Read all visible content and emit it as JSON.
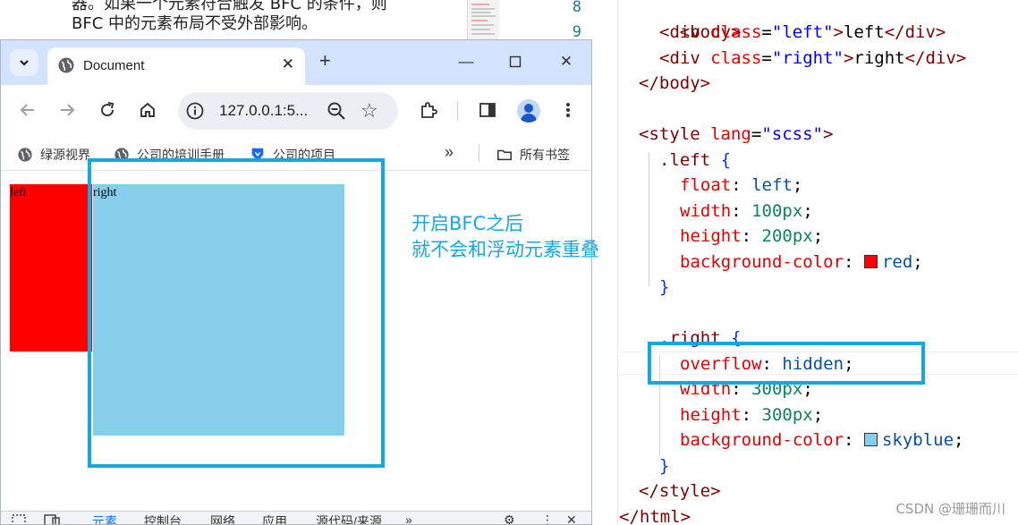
{
  "article": {
    "line1": "器。如果一个元素符合触发 BFC 的条件，则",
    "line2": "BFC 中的元素布局不受外部影响。"
  },
  "editor": {
    "line_numbers": [
      "8",
      "9"
    ],
    "code": {
      "l1_tag": "<body>",
      "l2_open": "<div",
      "l2_attr": "class",
      "l2_eq": "=",
      "l2_val": "\"left\"",
      "l2_gt": ">",
      "l2_text": "left",
      "l2_close": "</div>",
      "l3_open": "<div",
      "l3_attr": "class",
      "l3_eq": "=",
      "l3_val": "\"right\"",
      "l3_gt": ">",
      "l3_text": "right",
      "l3_close": "</div>",
      "l4_tag": "</body>",
      "l6_open": "<style",
      "l6_attr": "lang",
      "l6_eq": "=",
      "l6_val": "\"scss\"",
      "l6_gt": ">",
      "l7_sel": ".left",
      "l7_brace": "{",
      "l8_prop": "float",
      "l8_colon": ":",
      "l8_val": "left",
      "l8_semi": ";",
      "l9_prop": "width",
      "l9_colon": ":",
      "l9_val": "100px",
      "l9_semi": ";",
      "l10_prop": "height",
      "l10_colon": ":",
      "l10_val": "200px",
      "l10_semi": ";",
      "l11_prop": "background-color",
      "l11_colon": ":",
      "l11_val": "red",
      "l11_semi": ";",
      "l12_brace": "}",
      "l14_sel": ".right",
      "l14_brace": "{",
      "l15_prop": "overflow",
      "l15_colon": ":",
      "l15_val": "hidden",
      "l15_semi": ";",
      "l16_prop": "width",
      "l16_colon": ":",
      "l16_val": "300px",
      "l16_semi": ";",
      "l17_prop": "height",
      "l17_colon": ":",
      "l17_val": "300px",
      "l17_semi": ";",
      "l18_prop": "background-color",
      "l18_colon": ":",
      "l18_val": "skyblue",
      "l18_semi": ";",
      "l19_brace": "}",
      "l20_tag": "</style>",
      "l21_tag": "</html>"
    },
    "swatch_red": "#ff0000",
    "swatch_skyblue": "#87ceeb"
  },
  "browser": {
    "tab_title": "Document",
    "new_tab": "+",
    "url": "127.0.0.1:5...",
    "bookmarks": [
      "绿源视界",
      "公司的培训手册",
      "公司的项目"
    ],
    "bookmarks_more": "»",
    "all_bookmarks": "所有书签",
    "page": {
      "left_label": "left",
      "right_label": "right"
    },
    "devtools_tabs": [
      "元素",
      "控制台",
      "网络",
      "应用",
      "源代码/来源"
    ],
    "devtools_more": "»"
  },
  "annotation": {
    "line1": "开启BFC之后",
    "line2": "就不会和浮动元素重叠",
    "color": "#14a8e0"
  },
  "watermark": "CSDN @珊珊而川",
  "icons": {
    "tab_search": "chevron-down-icon",
    "tab_favicon": "globe-icon",
    "close": "close-icon",
    "minimize": "minimize-icon",
    "maximize": "maximize-icon",
    "back": "back-arrow-icon",
    "forward": "forward-arrow-icon",
    "reload": "reload-icon",
    "home": "home-icon",
    "site_info": "info-icon",
    "zoom": "zoom-out-icon",
    "bookmark_star": "star-icon",
    "extensions": "puzzle-icon",
    "side_panel": "side-panel-icon",
    "profile": "profile-icon",
    "menu": "more-vert-icon",
    "folder": "folder-icon"
  }
}
